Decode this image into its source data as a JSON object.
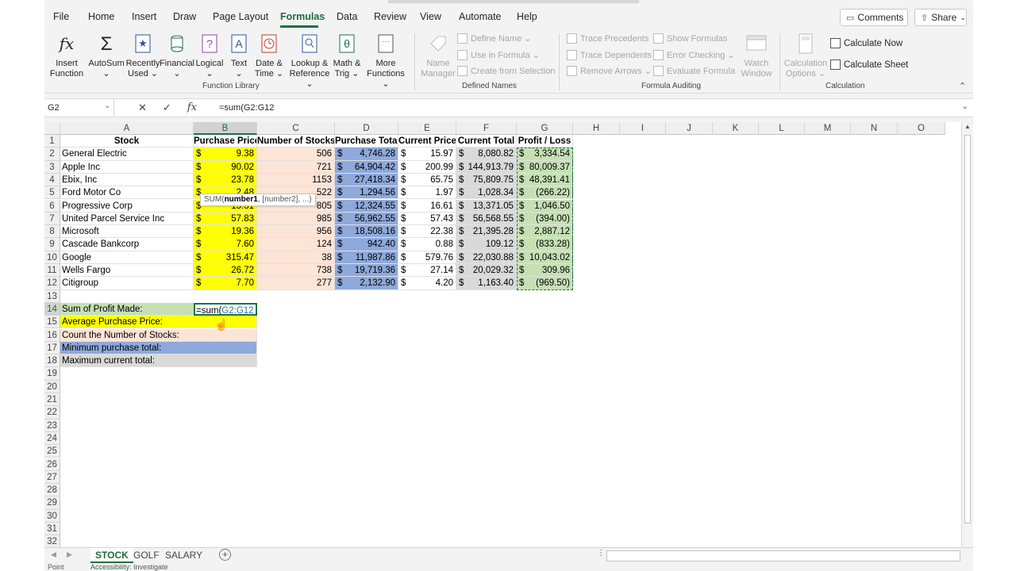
{
  "ribbon_tabs": [
    "File",
    "Home",
    "Insert",
    "Draw",
    "Page Layout",
    "Formulas",
    "Data",
    "Review",
    "View",
    "Automate",
    "Help"
  ],
  "active_tab": "Formulas",
  "top_buttons": {
    "comments": "Comments",
    "share": "Share"
  },
  "function_library": {
    "label": "Function Library",
    "buttons": [
      {
        "line1": "Insert",
        "line2": "Function",
        "icon": "fx-icon"
      },
      {
        "line1": "AutoSum",
        "line2": "⌄",
        "icon": "sigma-icon"
      },
      {
        "line1": "Recently",
        "line2": "Used ⌄",
        "icon": "star-icon"
      },
      {
        "line1": "Financial",
        "line2": "⌄",
        "icon": "database-icon"
      },
      {
        "line1": "Logical",
        "line2": "⌄",
        "icon": "question-icon"
      },
      {
        "line1": "Text",
        "line2": "⌄",
        "icon": "text-a-icon"
      },
      {
        "line1": "Date &",
        "line2": "Time ⌄",
        "icon": "clock-icon"
      },
      {
        "line1": "Lookup &",
        "line2": "Reference ⌄",
        "icon": "magnifier-icon"
      },
      {
        "line1": "Math &",
        "line2": "Trig ⌄",
        "icon": "theta-icon"
      },
      {
        "line1": "More",
        "line2": "Functions ⌄",
        "icon": "more-icon"
      }
    ]
  },
  "defined_names": {
    "label": "Defined Names",
    "name_manager": {
      "line1": "Name",
      "line2": "Manager"
    },
    "items": [
      "Define Name ⌄",
      "Use in Formula ⌄",
      "Create from Selection"
    ]
  },
  "formula_auditing": {
    "label": "Formula Auditing",
    "items_left": [
      "Trace Precedents",
      "Trace Dependents",
      "Remove Arrows ⌄"
    ],
    "items_right": [
      "Show Formulas",
      "Error Checking ⌄",
      "Evaluate Formula"
    ],
    "watch": {
      "line1": "Watch",
      "line2": "Window"
    }
  },
  "calculation": {
    "label": "Calculation",
    "options": {
      "line1": "Calculation",
      "line2": "Options ⌄"
    },
    "calc_now": "Calculate Now",
    "calc_sheet": "Calculate Sheet"
  },
  "formula_bar": {
    "name_box": "G2",
    "formula": "=sum(G2:G12"
  },
  "columns": [
    "A",
    "B",
    "C",
    "D",
    "E",
    "F",
    "G",
    "H",
    "I",
    "J",
    "K",
    "L",
    "M",
    "N",
    "O"
  ],
  "headers": [
    "Stock",
    "Purchase Price",
    "Number of Stocks",
    "Purchase Total",
    "Current Price",
    "Current Total",
    "Profit / Loss"
  ],
  "rows": [
    [
      "General Electric",
      "9.38",
      "506",
      "4,746.28",
      "15.97",
      "8,080.82",
      "3,334.54"
    ],
    [
      "Apple Inc",
      "90.02",
      "721",
      "64,904.42",
      "200.99",
      "144,913.79",
      "80,009.37"
    ],
    [
      "Ebix, Inc",
      "23.78",
      "1153",
      "27,418.34",
      "65.75",
      "75,809.75",
      "48,391.41"
    ],
    [
      "Ford Motor Co",
      "2.48",
      "522",
      "1,294.56",
      "1.97",
      "1,028.34",
      "(266.22)"
    ],
    [
      "Progressive Corp",
      "15.31",
      "805",
      "12,324.55",
      "16.61",
      "13,371.05",
      "1,046.50"
    ],
    [
      "United Parcel Service Inc",
      "57.83",
      "985",
      "56,962.55",
      "57.43",
      "56,568.55",
      "(394.00)"
    ],
    [
      "Microsoft",
      "19.36",
      "956",
      "18,508.16",
      "22.38",
      "21,395.28",
      "2,887.12"
    ],
    [
      "Cascade Bankcorp",
      "7.60",
      "124",
      "942.40",
      "0.88",
      "109.12",
      "(833.28)"
    ],
    [
      "Google",
      "315.47",
      "38",
      "11,987.86",
      "579.76",
      "22,030.88",
      "10,043.02"
    ],
    [
      "Wells Fargo",
      "26.72",
      "738",
      "19,719.36",
      "27.14",
      "20,029.32",
      "309.96"
    ],
    [
      "Citigroup",
      "7.70",
      "277",
      "2,132.90",
      "4.20",
      "1,163.40",
      "(969.50)"
    ]
  ],
  "currency_symbol": "$",
  "summary": [
    {
      "label": "Sum of Profit Made:",
      "color": "#c6e0b4"
    },
    {
      "label": "Average Purchase Price:",
      "color": "#ffff00"
    },
    {
      "label": "Count the Number of Stocks:",
      "color": "#fce4d6"
    },
    {
      "label": "Minimum purchase total:",
      "color": "#8ea9db"
    },
    {
      "label": "Maximum current total:",
      "color": "#d9d9d9"
    }
  ],
  "editing_cell": {
    "prefix": "=sum(",
    "ref": "G2:G12"
  },
  "tooltip": {
    "fn": "SUM(",
    "arg1": "number1",
    "rest": ", [number2], ...)"
  },
  "row_numbers": [
    "1",
    "2",
    "3",
    "4",
    "5",
    "6",
    "7",
    "8",
    "9",
    "10",
    "11",
    "12",
    "13",
    "14",
    "15",
    "16",
    "17",
    "18",
    "19",
    "20",
    "21",
    "22",
    "23",
    "24",
    "25",
    "26",
    "27",
    "28",
    "29",
    "30",
    "31",
    "32"
  ],
  "sheet_tabs": [
    "STOCK",
    "GOLF",
    "SALARY"
  ],
  "active_sheet": "STOCK",
  "status": {
    "mode": "Point",
    "accessibility": "Accessibility: Investigate"
  },
  "colors": {
    "purchase_price": "#ffff00",
    "num_stocks": "#fce4d6",
    "purchase_total": "#8ea9db",
    "current_total": "#d9d9d9",
    "profit": "#c6e0b4",
    "accent": "#1e7145"
  }
}
